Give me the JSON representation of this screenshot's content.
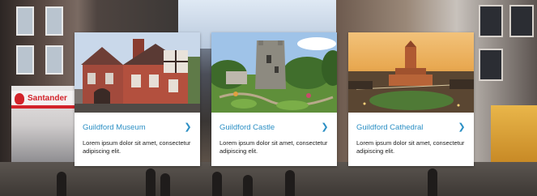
{
  "colors": {
    "accent": "#2b8fc4",
    "card_bg": "#ffffff",
    "text": "#222222"
  },
  "backdrop": {
    "shop_sign": "Santander"
  },
  "cards": [
    {
      "title": "Guildford Museum",
      "description": "Lorem ipsum dolor sit amet, consectetur adipiscing elit.",
      "icon": "chevron-right-icon"
    },
    {
      "title": "Guildford Castle",
      "description": "Lorem ipsum dolor sit amet, consectetur adipiscing elit.",
      "icon": "chevron-right-icon"
    },
    {
      "title": "Guildford Cathedral",
      "description": "Lorem ipsum dolor sit amet, consectetur adipiscing elit.",
      "icon": "chevron-right-icon"
    }
  ]
}
